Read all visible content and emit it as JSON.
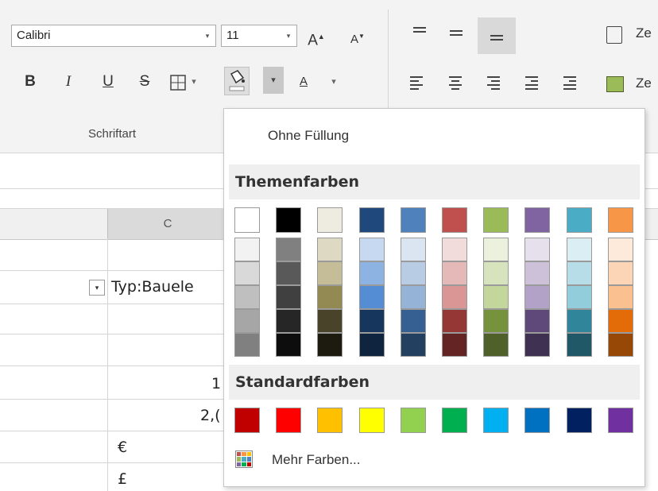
{
  "ribbon": {
    "font_name": "Calibri",
    "font_size": "11",
    "grow_font_label": "A",
    "shrink_font_label": "A",
    "bold_label": "B",
    "italic_label": "I",
    "underline_label": "U",
    "strike_label": "S",
    "font_color_label": "A",
    "dropdown_arrow": "▾",
    "group_label": "Schriftart",
    "right_top_label": "Ze",
    "right_bottom_label": "Ze"
  },
  "sheet": {
    "column_c": "C",
    "cells": {
      "typ": "Typ:Bauele",
      "val1": "1",
      "val2": "2,(",
      "euro": "€",
      "pound": "£"
    }
  },
  "fill_menu": {
    "no_fill": "Ohne Füllung",
    "theme_header": "Themenfarben",
    "standard_header": "Standardfarben",
    "more_colors": "Mehr Farben...",
    "theme_top": [
      "#FFFFFF",
      "#000000",
      "#EEECE1",
      "#1F497D",
      "#4F81BD",
      "#C0504D",
      "#9BBB59",
      "#8064A2",
      "#4BACC6",
      "#F79646"
    ],
    "theme_shades": [
      [
        "#F2F2F2",
        "#D9D9D9",
        "#BFBFBF",
        "#A6A6A6",
        "#808080"
      ],
      [
        "#808080",
        "#595959",
        "#404040",
        "#262626",
        "#0D0D0D"
      ],
      [
        "#DDD9C3",
        "#C4BD97",
        "#938953",
        "#494429",
        "#1D1B10"
      ],
      [
        "#C6D9F0",
        "#8DB3E2",
        "#548DD4",
        "#17365D",
        "#0F243E"
      ],
      [
        "#DBE5F1",
        "#B8CCE4",
        "#95B3D7",
        "#366092",
        "#244061"
      ],
      [
        "#F2DCDB",
        "#E5B9B7",
        "#D99694",
        "#953734",
        "#632423"
      ],
      [
        "#EBF1DD",
        "#D7E3BC",
        "#C3D69B",
        "#76923C",
        "#4F6128"
      ],
      [
        "#E5E0EC",
        "#CCC1D9",
        "#B2A2C7",
        "#5F497A",
        "#3F3151"
      ],
      [
        "#DBEEF3",
        "#B7DDE8",
        "#92CDDC",
        "#31859B",
        "#205867"
      ],
      [
        "#FDEADA",
        "#FBD5B5",
        "#FAC08F",
        "#E36C09",
        "#974806"
      ]
    ],
    "standard": [
      "#C00000",
      "#FF0000",
      "#FFC000",
      "#FFFF00",
      "#92D050",
      "#00B050",
      "#00B0F0",
      "#0070C0",
      "#002060",
      "#7030A0"
    ]
  }
}
